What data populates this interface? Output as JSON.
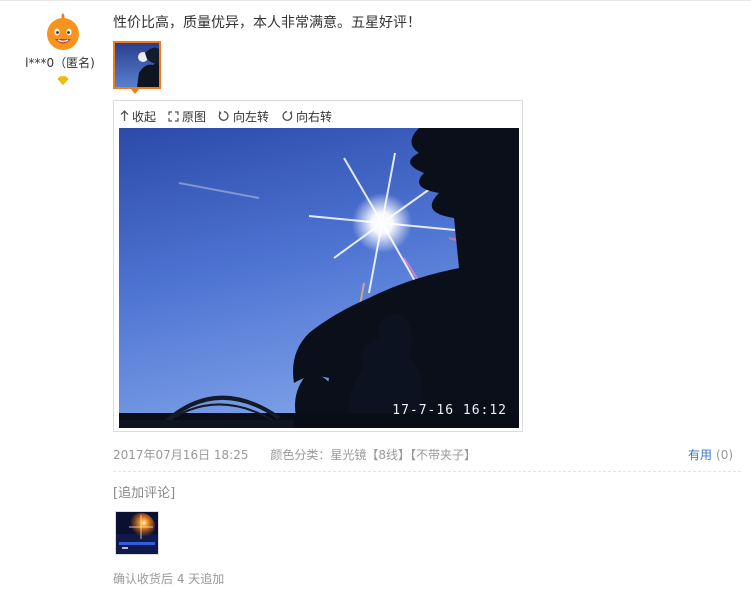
{
  "reviewer": {
    "avatar_icon": "mascot-avatar-icon",
    "name": "l***0（匿名)",
    "level_icon": "diamond-level-icon",
    "level_color": "#f5c400"
  },
  "review": {
    "text": "性价比高，质量优异，本人非常满意。五星好评！",
    "date": "2017年07月16日 18:25",
    "sku": "颜色分类：星光镜【8线】【不带夹子】"
  },
  "viewer": {
    "toolbar": {
      "collapse": "收起",
      "original": "原图",
      "rotate_left": "向左转",
      "rotate_right": "向右转"
    },
    "photo_timestamp": "17-7-16 16:12"
  },
  "feedback": {
    "useful_label": "有用",
    "useful_count": "(0)"
  },
  "append": {
    "title": "[追加评论]",
    "note": "确认收货后 4 天追加"
  },
  "colors": {
    "accent": "#f07d19",
    "link": "#3c78c8",
    "muted": "#999999"
  }
}
